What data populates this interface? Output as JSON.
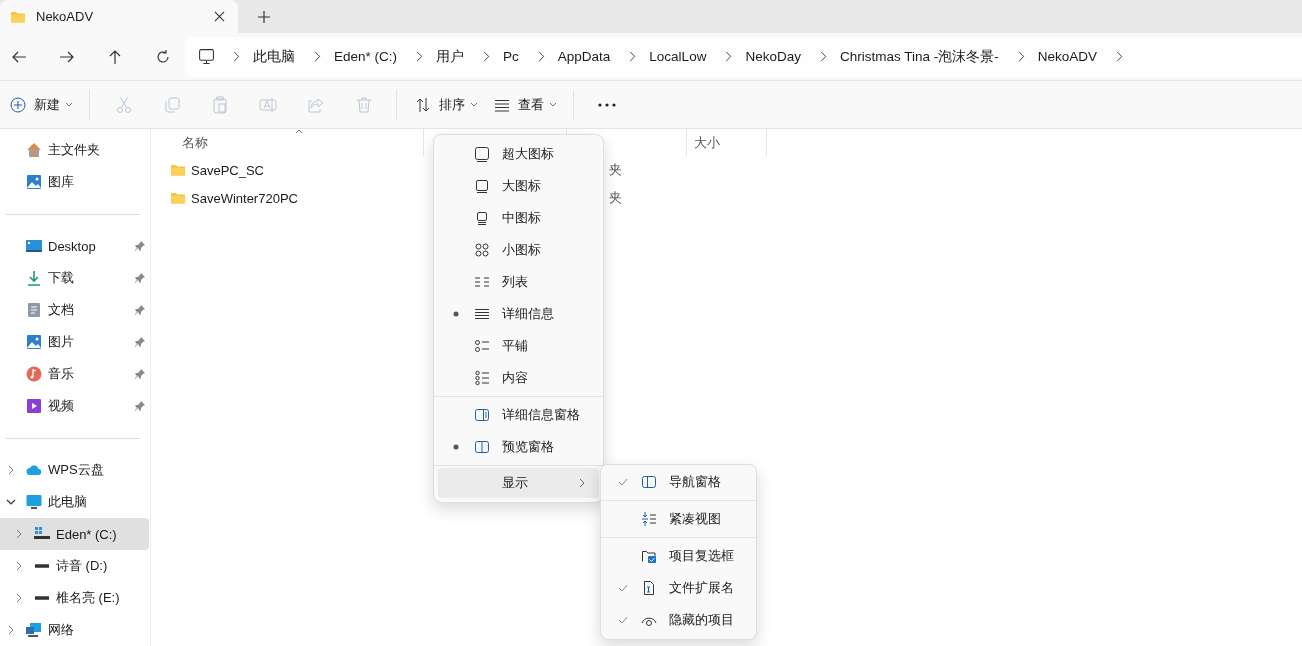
{
  "tab": {
    "title": "NekoADV",
    "selected": true
  },
  "address": {
    "crumbs": [
      "此电脑",
      "Eden* (C:)",
      "用户",
      "Pc",
      "AppData",
      "LocalLow",
      "NekoDay",
      "Christmas Tina -泡沫冬景-",
      "NekoADV"
    ]
  },
  "toolbar": {
    "new_label": "新建",
    "sort_label": "排序",
    "view_label": "查看",
    "actions": [
      {
        "kind": "cut",
        "disabled": true
      },
      {
        "kind": "copy",
        "disabled": true
      },
      {
        "kind": "paste",
        "disabled": true
      },
      {
        "kind": "rename",
        "disabled": true
      },
      {
        "kind": "share",
        "disabled": true
      },
      {
        "kind": "delete",
        "disabled": true
      }
    ]
  },
  "sidebar": {
    "sections": [
      [
        {
          "label": "主文件夹",
          "kind": "home"
        },
        {
          "label": "图库",
          "kind": "gallery"
        }
      ],
      [
        {
          "label": "Desktop",
          "kind": "desktop",
          "pinned": true
        },
        {
          "label": "下载",
          "kind": "download",
          "pinned": true
        },
        {
          "label": "文档",
          "kind": "documents",
          "pinned": true
        },
        {
          "label": "图片",
          "kind": "pictures",
          "pinned": true
        },
        {
          "label": "音乐",
          "kind": "music",
          "pinned": true
        },
        {
          "label": "视频",
          "kind": "videos",
          "pinned": true
        }
      ],
      [
        {
          "label": "WPS云盘",
          "kind": "cloud",
          "expanded": false,
          "selected": false
        },
        {
          "label": "此电脑",
          "kind": "pc",
          "expanded": true,
          "selected": false,
          "children": [
            {
              "label": "Eden* (C:)",
              "kind": "os_drive",
              "expanded": false,
              "selected": true
            },
            {
              "label": "诗音 (D:)",
              "kind": "drive",
              "expanded": false,
              "selected": false
            },
            {
              "label": "椎名亮 (E:)",
              "kind": "drive",
              "expanded": false,
              "selected": false
            }
          ]
        },
        {
          "label": "网络",
          "kind": "network",
          "expanded": false,
          "selected": false
        }
      ]
    ]
  },
  "columns": [
    {
      "label": "名称"
    },
    {
      "label": "大小"
    }
  ],
  "files": [
    {
      "name": "SavePC_SC",
      "type": "夹"
    },
    {
      "name": "SaveWinter720PC",
      "type": "夹"
    }
  ],
  "view_menu": {
    "groups": [
      [
        {
          "label": "超大图标",
          "kind": "xl",
          "selected": false
        },
        {
          "label": "大图标",
          "kind": "large",
          "selected": false
        },
        {
          "label": "中图标",
          "kind": "medium",
          "selected": false
        },
        {
          "label": "小图标",
          "kind": "small",
          "selected": false
        },
        {
          "label": "列表",
          "kind": "list",
          "selected": false
        },
        {
          "label": "详细信息",
          "kind": "details",
          "selected": true
        },
        {
          "label": "平铺",
          "kind": "tiles",
          "selected": false
        },
        {
          "label": "内容",
          "kind": "content",
          "selected": false
        }
      ],
      [
        {
          "label": "详细信息窗格",
          "kind": "details_pane",
          "selected": false
        },
        {
          "label": "预览窗格",
          "kind": "preview_pane",
          "selected": true
        }
      ]
    ],
    "show": {
      "label": "显示",
      "expanded": true
    }
  },
  "show_menu": {
    "groups": [
      [
        {
          "label": "导航窗格",
          "kind": "nav_pane",
          "checked": true
        }
      ],
      [
        {
          "label": "紧凑视图",
          "kind": "compact",
          "checked": false
        }
      ],
      [
        {
          "label": "项目复选框",
          "kind": "checkboxes",
          "checked": false
        },
        {
          "label": "文件扩展名",
          "kind": "extensions",
          "checked": true
        },
        {
          "label": "隐藏的项目",
          "kind": "hidden",
          "checked": true
        }
      ]
    ]
  }
}
